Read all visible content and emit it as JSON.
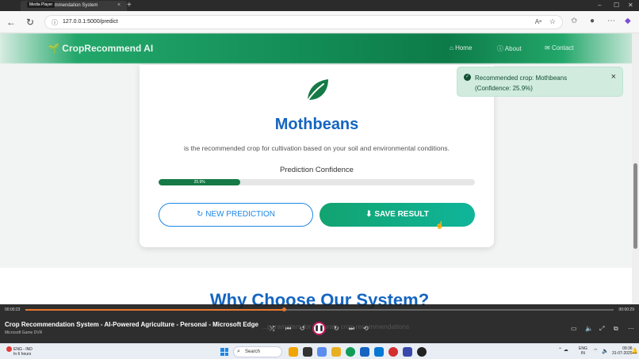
{
  "window": {
    "tab_title": "Crop Recommendation System",
    "media_tag": "Media Player",
    "tab_close": "×",
    "new_tab": "+"
  },
  "addressbar": {
    "url": "127.0.0.1:5000/predict"
  },
  "site": {
    "brand": "CropRecommend AI",
    "nav": [
      "Home",
      "About",
      "Contact"
    ]
  },
  "result": {
    "crop": "Mothbeans",
    "description": "is the recommended crop for cultivation based on your soil and environmental conditions.",
    "confidence_label": "Prediction Confidence",
    "confidence_text": "25.9%",
    "confidence_value": 25.9,
    "new_button": "NEW PREDICTION",
    "save_button": "SAVE RESULT"
  },
  "section": {
    "heading": "Why Choose Our System?"
  },
  "toast": {
    "line1": "Recommended crop: Mothbeans",
    "line2": "(Confidence: 25.9%)",
    "close": "×"
  },
  "media": {
    "elapsed": "00:00:23",
    "total": "00:00:29",
    "progress": 0.44,
    "title": "Crop Recommendation System - AI-Powered Agriculture - Personal - Microsoft Edge",
    "subtitle": "Microsoft Game DVR",
    "overlay_text": "...parameters for accurate crop recommendations"
  },
  "taskbar": {
    "weather_line1": "ENG - IND",
    "weather_line2": "In 6 hours",
    "search": "Search",
    "lang_line1": "ENG",
    "lang_line2": "IN",
    "time": "09:36",
    "date": "31-07-2025"
  },
  "colors": {
    "brand_green": "#157a45",
    "crop_blue": "#1565c0",
    "outline_blue": "#1e88e5",
    "save_teal": "#10b59a",
    "toast_bg": "#d1ecdf"
  }
}
